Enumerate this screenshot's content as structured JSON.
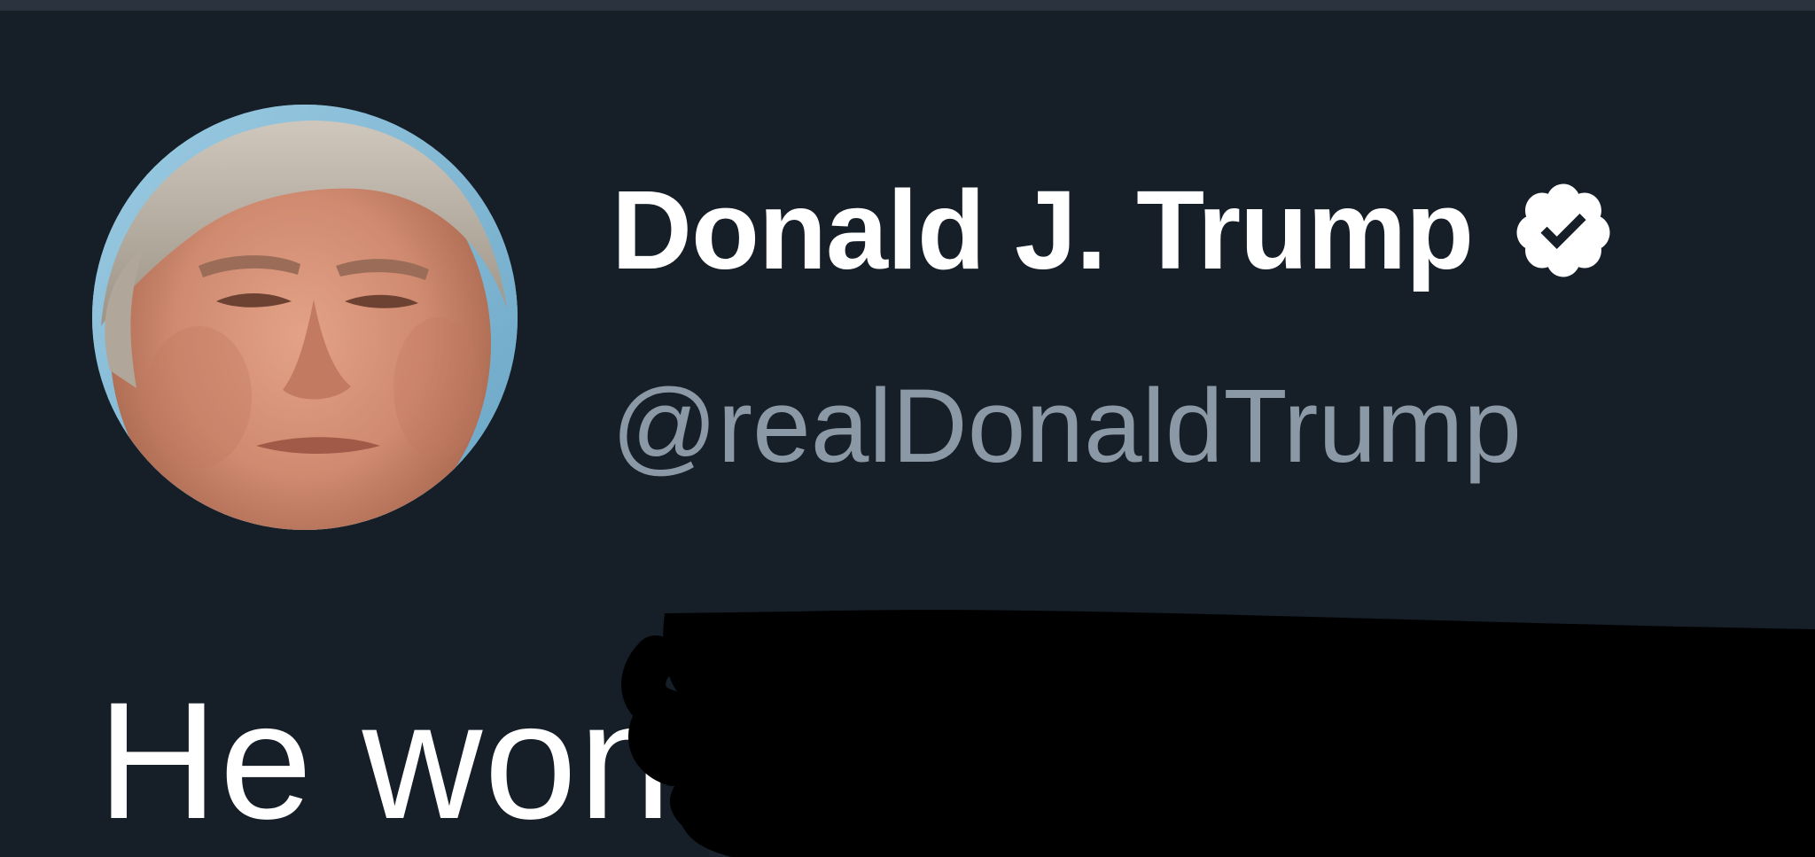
{
  "tweet": {
    "author": {
      "display_name": "Donald J. Trump",
      "handle": "@realDonaldTrump",
      "verified": true
    },
    "text_visible": "He won",
    "text_redacted": true
  },
  "icons": {
    "verified": "verified-badge-icon",
    "avatar": "profile-photo"
  },
  "colors": {
    "background": "#161e28",
    "display_name": "#ffffff",
    "handle": "#8b98a5",
    "redaction": "#000000"
  }
}
